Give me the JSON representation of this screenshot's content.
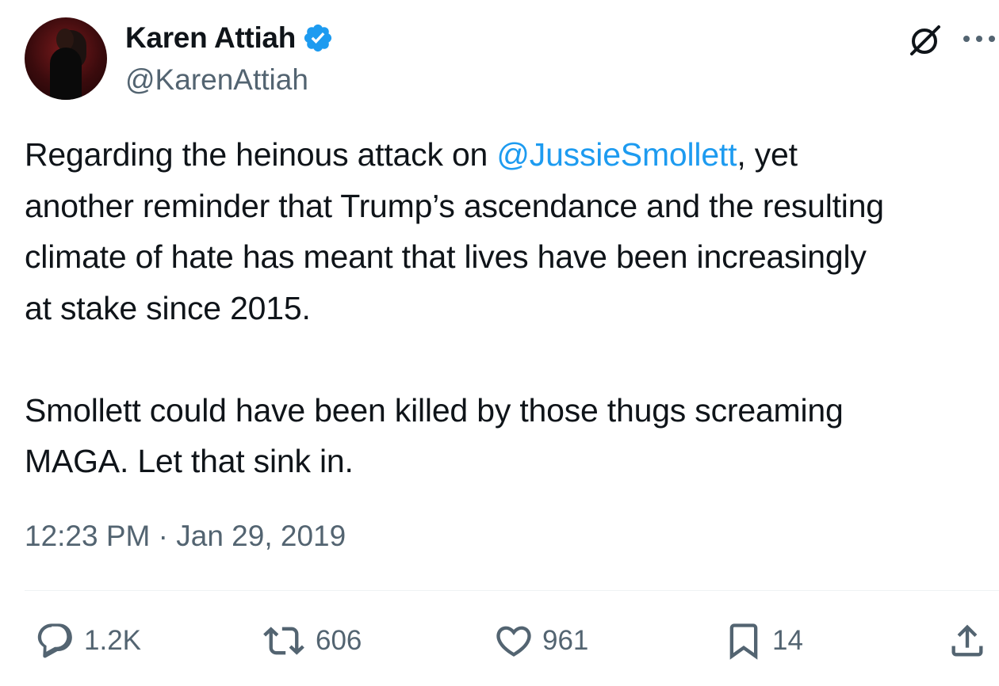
{
  "author": {
    "name": "Karen Attiah",
    "handle": "@KarenAttiah",
    "verified": true,
    "verified_color": "#1d9bf0"
  },
  "tweet": {
    "lines": [
      {
        "pre": "Regarding the heinous attack on ",
        "mention": "@JussieSmollett",
        "post": ", yet"
      },
      {
        "text": "another reminder that  Trump’s ascendance and the resulting"
      },
      {
        "text": "climate of hate has meant that lives have been increasingly"
      },
      {
        "text": "at stake since 2015."
      },
      {
        "text": ""
      },
      {
        "text": "Smollett could have been killed by those thugs screaming"
      },
      {
        "text": "MAGA. Let that sink in."
      }
    ],
    "timestamp": "12:23 PM · Jan 29, 2019"
  },
  "actions": {
    "replies": "1.2K",
    "retweets": "606",
    "likes": "961",
    "bookmarks": "14"
  },
  "icons": {
    "grok": "grok-icon",
    "more": "more-icon",
    "reply": "reply-icon",
    "retweet": "retweet-icon",
    "like": "heart-icon",
    "bookmark": "bookmark-icon",
    "share": "share-icon"
  },
  "colors": {
    "text": "#0f1419",
    "secondary": "#536471",
    "link": "#1d9bf0",
    "divider": "#eff3f4"
  }
}
